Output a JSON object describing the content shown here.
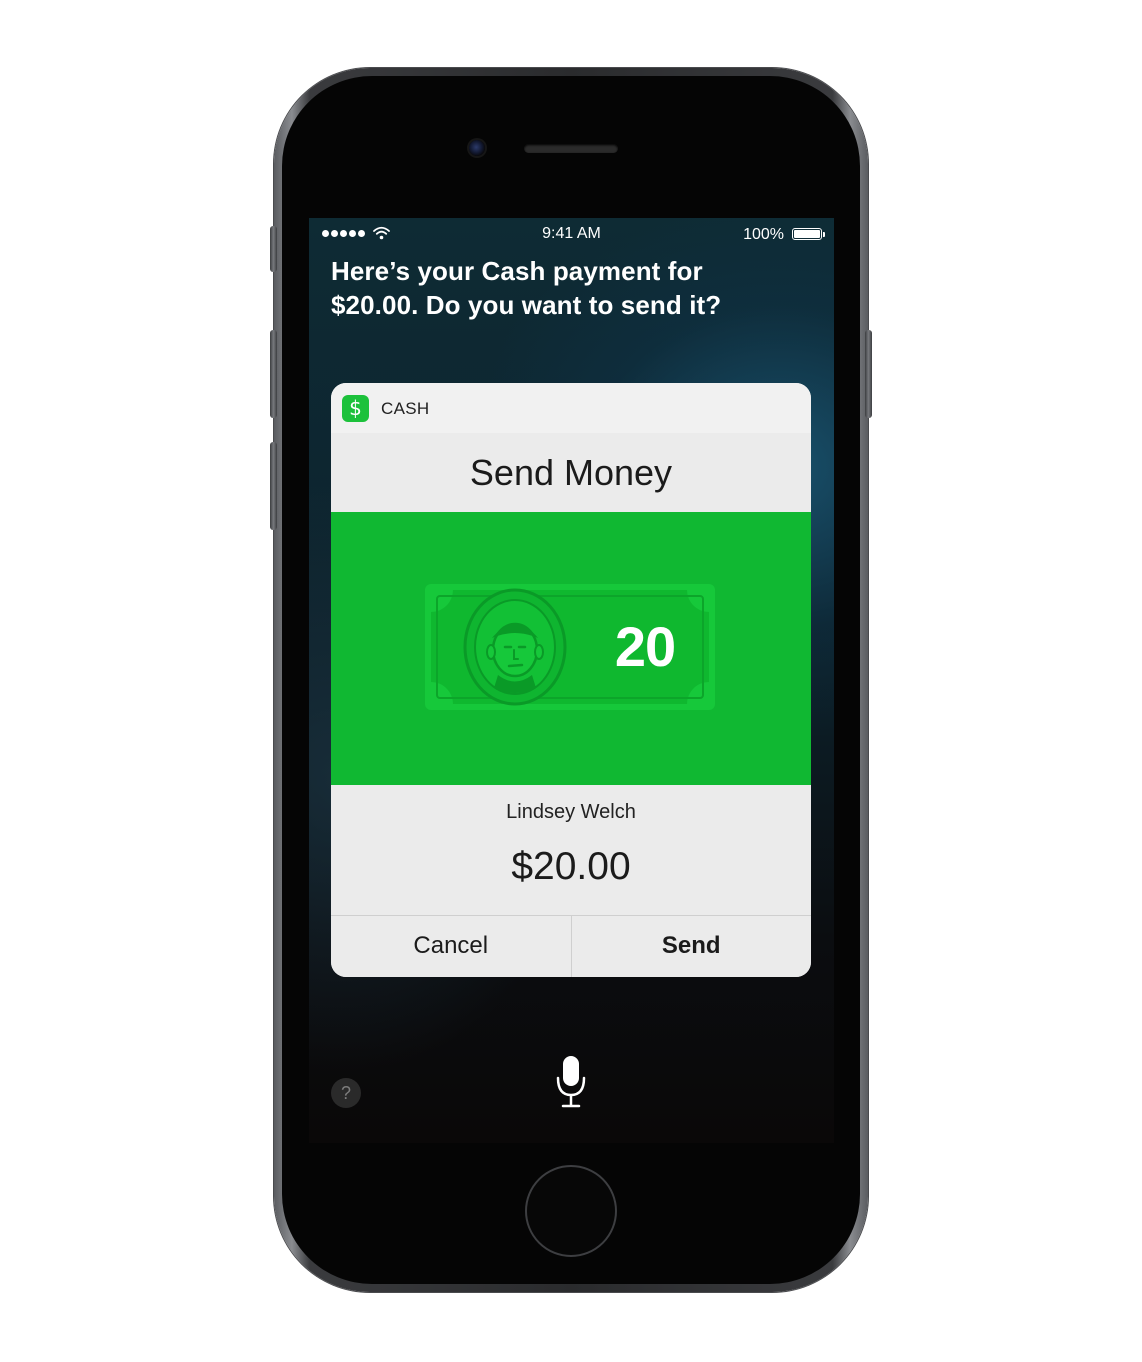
{
  "status_bar": {
    "time": "9:41 AM",
    "battery": "100%",
    "icons": [
      "signal-dots-icon",
      "wifi-icon",
      "battery-icon"
    ]
  },
  "siri": {
    "prompt": "Here’s your Cash payment for $20.00. Do you want to send it?",
    "help_label": "?",
    "icons": [
      "microphone-icon",
      "help-icon"
    ]
  },
  "card": {
    "app_name": "CASH",
    "app_icon_glyph": "$",
    "title": "Send Money",
    "bill_value": "20",
    "recipient": "Lindsey Welch",
    "amount": "$20.00",
    "cancel_label": "Cancel",
    "send_label": "Send"
  },
  "colors": {
    "cash_green": "#10b832",
    "app_icon_green": "#1cc13b",
    "card_background": "#ebebeb"
  }
}
